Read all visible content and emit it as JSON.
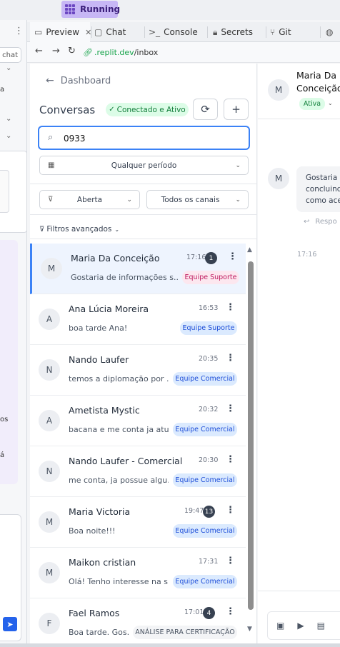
{
  "topbar": {
    "run_label": "Running"
  },
  "left_pane": {
    "chat_button": "chat",
    "text_a": "a",
    "text_os": "os",
    "text_a2": "á"
  },
  "tabs": [
    {
      "icon": "monitor-icon",
      "label": "Preview",
      "active": true,
      "closable": true
    },
    {
      "icon": "chat-icon",
      "label": "Chat"
    },
    {
      "icon": "terminal-icon",
      "label": "Console"
    },
    {
      "icon": "lock-icon",
      "label": "Secrets"
    },
    {
      "icon": "git-icon",
      "label": "Git"
    }
  ],
  "address": {
    "domain": ".replit.dev",
    "path": "/inbox"
  },
  "app": {
    "back_label": "Dashboard",
    "title": "Conversas",
    "status": "Conectado e Ativo",
    "search_value": "0933",
    "period": "Qualquer período",
    "status_filter": "Aberta",
    "channel_filter": "Todos os canais",
    "advanced_filters": "Filtros avançados"
  },
  "conversations": [
    {
      "initial": "M",
      "name": "Maria Da Conceição",
      "time": "17:16",
      "count": "1",
      "message": "Gostaria de informações s...",
      "tag": "Equipe Suporte",
      "tag_color": "pink",
      "selected": true
    },
    {
      "initial": "A",
      "name": "Ana Lúcia Moreira",
      "time": "16:53",
      "count": "",
      "message": "boa tarde Ana!",
      "tag": "Equipe Suporte",
      "tag_color": "blue"
    },
    {
      "initial": "N",
      "name": "Nando Laufer",
      "time": "20:35",
      "count": "",
      "message": "temos a diplomação por ...",
      "tag": "Equipe Comercial",
      "tag_color": "blue"
    },
    {
      "initial": "A",
      "name": "Ametista Mystic",
      "time": "20:32",
      "count": "",
      "message": "bacana e me conta ja atu...",
      "tag": "Equipe Comercial",
      "tag_color": "blue"
    },
    {
      "initial": "N",
      "name": "Nando Laufer - Comercial",
      "time": "20:30",
      "count": "",
      "message": "me conta, ja possue algu...",
      "tag": "Equipe Comercial",
      "tag_color": "blue"
    },
    {
      "initial": "M",
      "name": "Maria Victoria",
      "time": "19:47",
      "count": "13",
      "message": "Boa noite!!!",
      "tag": "Equipe Comercial",
      "tag_color": "blue"
    },
    {
      "initial": "M",
      "name": "Maikon cristian",
      "time": "17:31",
      "count": "",
      "message": "Olá! Tenho interesse na s...",
      "tag": "Equipe Comercial",
      "tag_color": "blue"
    },
    {
      "initial": "F",
      "name": "Fael Ramos",
      "time": "17:01",
      "count": "4",
      "message": "Boa tarde. Gos...",
      "tag": "ANÁLISE PARA CERTIFICAÇÃO",
      "tag_color": "gray"
    }
  ],
  "detail": {
    "initial": "M",
    "name_line1": "Maria Da",
    "name_line2": "Conceição",
    "status": "Ativa",
    "bubble_line1": "Gostaria d",
    "bubble_line2": "concluindo",
    "bubble_line3": "como ace",
    "reply_label": "Respo",
    "time": "17:16"
  },
  "colors": {
    "accent": "#3b82f6",
    "running": "#c7b7f5",
    "success": "#15803d"
  }
}
